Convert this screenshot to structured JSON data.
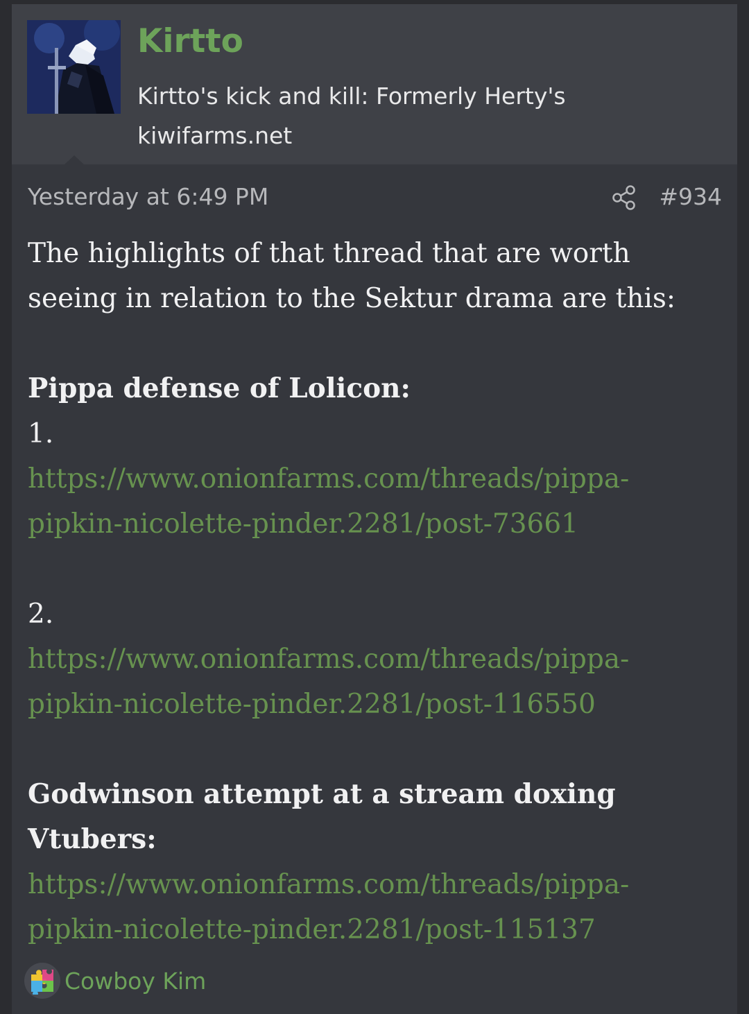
{
  "post": {
    "author": {
      "name": "Kirtto",
      "title_line1": "Kirtto's kick and kill: Formerly Herty's",
      "title_line2": "kiwifarms.net",
      "avatar_icon": "user-avatar-dark-knight"
    },
    "timestamp": "Yesterday at 6:49 PM",
    "share_icon": "share-icon",
    "number": "#934",
    "body": {
      "intro_line1": "The highlights of that thread that are worth",
      "intro_line2": "seeing in relation to the Sektur drama are this:",
      "section1_heading": "Pippa defense of Lolicon:",
      "item1_label": "1.",
      "link1_line1": "https://www.onionfarms.com/threads/pippa-",
      "link1_line2": "pipkin-nicolette-pinder.2281/post-73661",
      "item2_label": "2.",
      "link2_line1": "https://www.onionfarms.com/threads/pippa-",
      "link2_line2": "pipkin-nicolette-pinder.2281/post-116550",
      "section2_heading_line1": "Godwinson attempt at a stream doxing",
      "section2_heading_line2": "Vtubers:",
      "link3_line1": "https://www.onionfarms.com/threads/pippa-",
      "link3_line2": "pipkin-nicolette-pinder.2281/post-115137"
    },
    "reactions": {
      "icon": "puzzle-piece-reaction-icon",
      "user": "Cowboy Kim"
    }
  },
  "colors": {
    "page_bg": "#2b2c30",
    "post_bg": "#35373d",
    "header_bg": "#3f4147",
    "username": "#6da35a",
    "link": "#67924f",
    "text": "#f1f1f2",
    "meta": "#b7b8bb"
  }
}
